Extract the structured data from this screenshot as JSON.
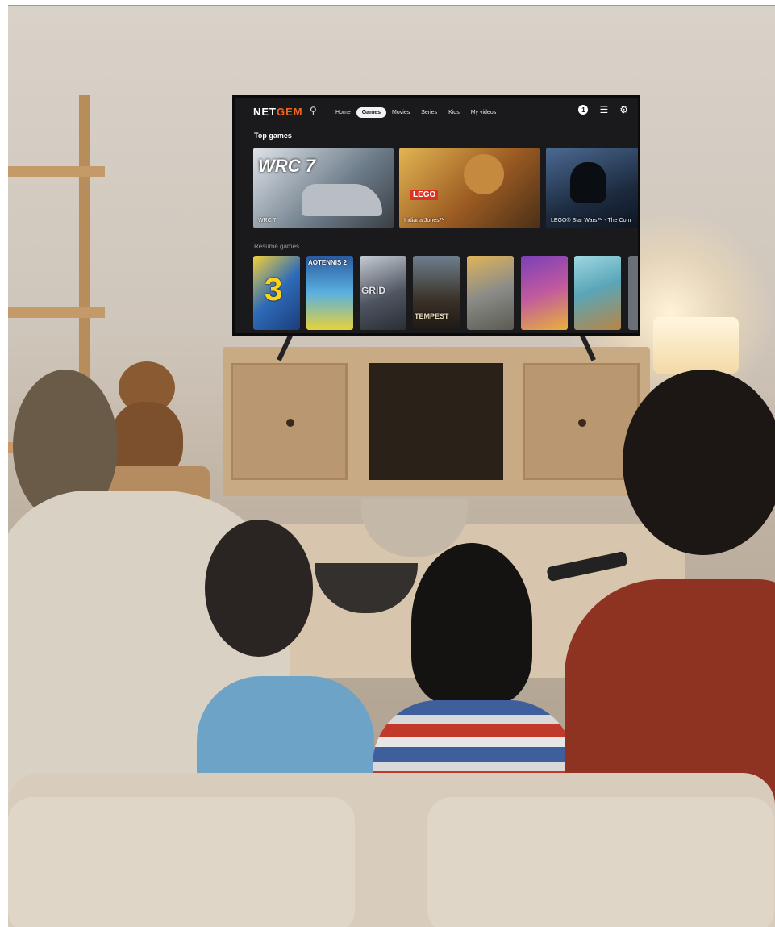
{
  "tv": {
    "logo": {
      "text_a": "NET",
      "text_b": "GEM"
    },
    "nav": {
      "items": [
        {
          "label": "Home"
        },
        {
          "label": "Games"
        },
        {
          "label": "Movies"
        },
        {
          "label": "Series"
        },
        {
          "label": "Kids"
        },
        {
          "label": "My videos"
        }
      ],
      "active": "Games",
      "notification_count": "1"
    },
    "top_games": {
      "title": "Top games",
      "cards": [
        {
          "caption": "WRC 7",
          "art_text": "WRC 7",
          "color": "#7d8a96"
        },
        {
          "caption": "Indiana Jones™",
          "art_text": "LEGO",
          "color": "#b7862f"
        },
        {
          "caption": "LEGO® Star Wars™ - The Com",
          "art_text": "",
          "color": "#24354d"
        }
      ]
    },
    "resume_games": {
      "title": "Resume games",
      "cards": [
        {
          "art_text": "3",
          "color": "#2e6bb8"
        },
        {
          "art_text": "AOTENNIS 2",
          "color": "#3c89c8"
        },
        {
          "art_text": "GRID",
          "color": "#4f5561"
        },
        {
          "art_text": "TEMPEST",
          "color": "#3a3128"
        },
        {
          "art_text": "",
          "color": "#8b8c88"
        },
        {
          "art_text": "",
          "color": "#c15a9e"
        },
        {
          "art_text": "",
          "color": "#5aa6b8"
        }
      ]
    }
  },
  "colors": {
    "accent": "#f0641e",
    "tv_bg": "#1a1a1c"
  }
}
